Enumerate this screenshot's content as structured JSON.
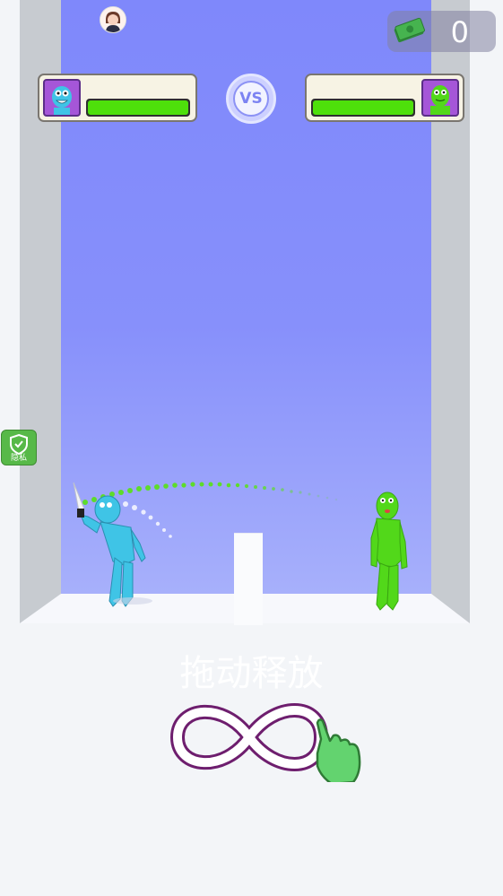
{
  "hud": {
    "money_value": "0",
    "vs_label": "VS"
  },
  "player": {
    "name": "blue-fighter",
    "health_fraction": 1.0,
    "color": "#3fc4e6"
  },
  "enemy": {
    "name": "green-fighter",
    "health_fraction": 1.0,
    "color": "#52d81a"
  },
  "privacy_button": {
    "label": "隐私"
  },
  "instruction": {
    "text": "拖动释放"
  },
  "colors": {
    "health_green": "#4ee00b",
    "sky": "#8790fb",
    "portrait_bg": "#a556d8",
    "trajectory": "#5ddc2a"
  }
}
